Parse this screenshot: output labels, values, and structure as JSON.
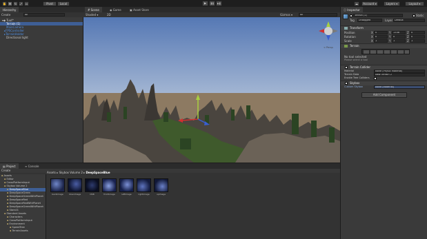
{
  "toolbar": {
    "play": "▶",
    "pause": "❚❚",
    "step": "▶❚",
    "pivot": "Pivot",
    "local": "Local",
    "account": "Account",
    "layers": "Layers",
    "layout": "Layout"
  },
  "hierarchy": {
    "tab": "Hierarchy",
    "create": "Create",
    "search_placeholder": "All",
    "items": [
      {
        "label": "Tuut*"
      },
      {
        "label": "Terrain (1)"
      },
      {
        "label": "MainCamera"
      },
      {
        "label": "FPSController"
      },
      {
        "label": "TerrainHolder"
      },
      {
        "label": "Directional light"
      }
    ]
  },
  "scene": {
    "tabs": [
      "Scene",
      "Game",
      "Asset Store"
    ],
    "shaded": "Shaded",
    "mode_2d": "2D",
    "gizmos": "Gizmos",
    "search": "All",
    "persp": "< Persp"
  },
  "inspector": {
    "tab": "Inspector",
    "object_name": "Terrain (1)",
    "static": "Static",
    "tag_label": "Tag",
    "tag_value": "Untagged",
    "layer_label": "Layer",
    "layer_value": "Default",
    "transform": "Transform",
    "position": {
      "label": "Position",
      "x": "0",
      "y": "1338",
      "z": "0"
    },
    "rotation": {
      "label": "Rotation",
      "x": "0",
      "y": "0",
      "z": "0"
    },
    "scale": {
      "label": "Scale",
      "x": "1",
      "y": "1",
      "z": "1"
    },
    "terrain": "Terrain",
    "no_tool": "No tool selected",
    "select_tool": "Please select a tool",
    "terrain_collider": "Terrain Collider",
    "material_label": "Material",
    "material_value": "None (Physic Material)",
    "terrain_data_label": "Terrain Data",
    "terrain_data_value": "New Terrain 2",
    "enable_trees": "Enable Tree Colliders",
    "skybox": "Skybox",
    "custom_skybox_label": "Custom Skybox",
    "custom_skybox_value": "None (Material)",
    "add_component": "Add Component"
  },
  "project": {
    "tabs": [
      "Project",
      "Console"
    ],
    "create": "Create",
    "breadcrumb": [
      "Assets",
      "Skybox Volume 2",
      "DeepSpaceBlue"
    ],
    "tree": [
      {
        "label": "Assets",
        "indent": 0
      },
      {
        "label": "Editor",
        "indent": 1
      },
      {
        "label": "CrossPlatformInput",
        "indent": 1
      },
      {
        "label": "Skybox Volume 2",
        "indent": 1
      },
      {
        "label": "DeepSpaceBlue",
        "indent": 2
      },
      {
        "label": "DeepSpaceGreen",
        "indent": 2
      },
      {
        "label": "DeepSpaceGreenWithPlanet",
        "indent": 2
      },
      {
        "label": "DeepSpaceRed",
        "indent": 2
      },
      {
        "label": "DeepSpaceRedWithPlanet",
        "indent": 2
      },
      {
        "label": "DeepSpaceGreenWithPlanet",
        "indent": 2
      },
      {
        "label": "Stars01",
        "indent": 2
      },
      {
        "label": "Standard Assets",
        "indent": 1
      },
      {
        "label": "Characters",
        "indent": 2
      },
      {
        "label": "CrossPlatformInput",
        "indent": 2
      },
      {
        "label": "Environment",
        "indent": 2
      },
      {
        "label": "SpeedTree",
        "indent": 3
      },
      {
        "label": "TerrainAssets",
        "indent": 3
      }
    ],
    "assets": [
      {
        "label": "backImage"
      },
      {
        "label": "downImage"
      },
      {
        "label": "DSB"
      },
      {
        "label": "frontImage"
      },
      {
        "label": "leftImage"
      },
      {
        "label": "rightImage"
      },
      {
        "label": "upImage"
      }
    ]
  }
}
